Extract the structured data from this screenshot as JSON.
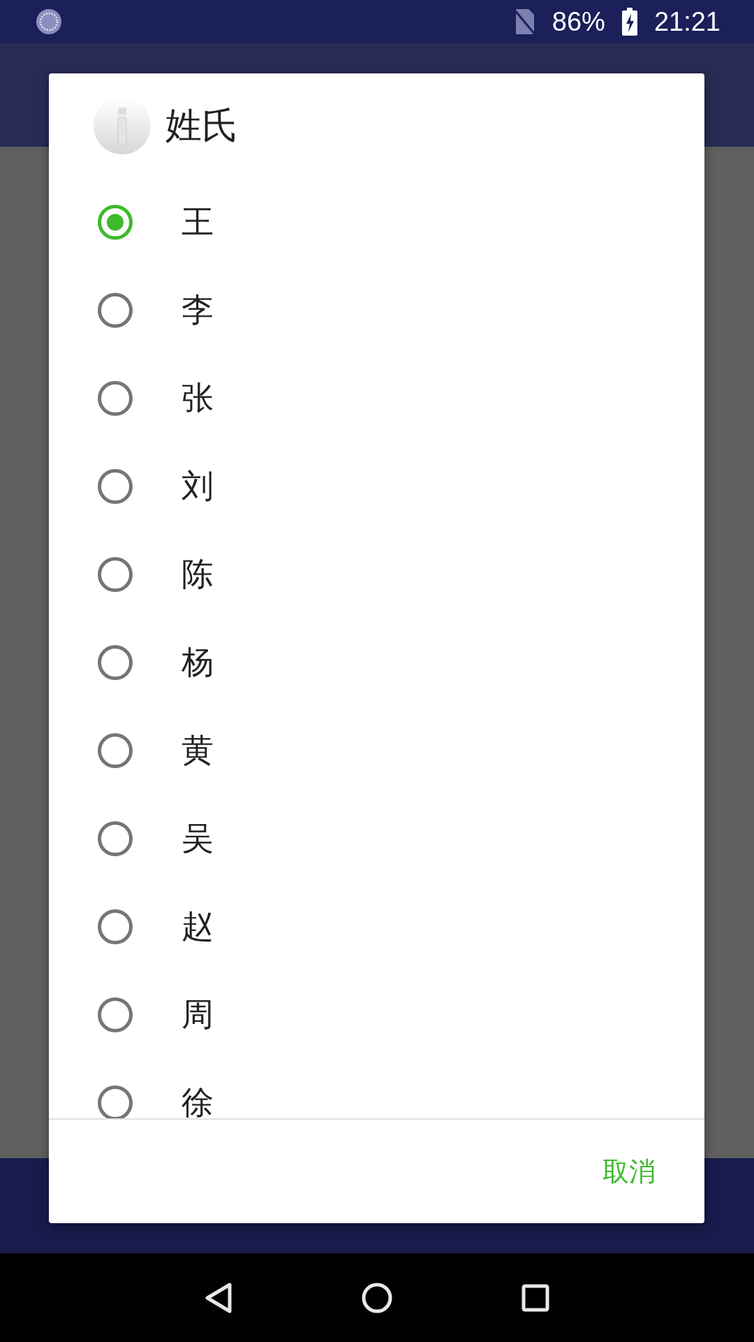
{
  "status_bar": {
    "battery": "86%",
    "time": "21:21"
  },
  "dialog": {
    "title": "姓氏",
    "options": [
      {
        "label": "王",
        "selected": true
      },
      {
        "label": "李",
        "selected": false
      },
      {
        "label": "张",
        "selected": false
      },
      {
        "label": "刘",
        "selected": false
      },
      {
        "label": "陈",
        "selected": false
      },
      {
        "label": "杨",
        "selected": false
      },
      {
        "label": "黄",
        "selected": false
      },
      {
        "label": "吴",
        "selected": false
      },
      {
        "label": "赵",
        "selected": false
      },
      {
        "label": "周",
        "selected": false
      },
      {
        "label": "徐",
        "selected": false
      }
    ],
    "buttons": [
      "取消"
    ]
  }
}
